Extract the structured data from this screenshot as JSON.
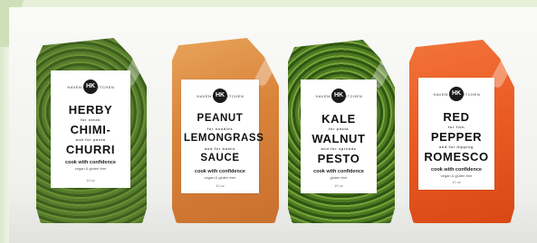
{
  "brand": {
    "left": "HAVEN'S",
    "right": "KITCHEN",
    "logo": "HK"
  },
  "products": [
    {
      "lines": [
        "HERBY",
        "CHIMI-",
        "CHURRI"
      ],
      "note1": "for steak",
      "note2": "and for pasta",
      "tagline": "cook with confidence",
      "diet": "vegan & gluten free",
      "net": "10 oz"
    },
    {
      "lines": [
        "PEANUT",
        "LEMONGRASS",
        "SAUCE"
      ],
      "note1": "for noodles",
      "note2": "and for bowls",
      "tagline": "cook with confidence",
      "diet": "vegan & gluten free",
      "net": "10 oz"
    },
    {
      "lines": [
        "KALE",
        "WALNUT",
        "PESTO"
      ],
      "note1": "for pasta",
      "note2": "and for spreads",
      "tagline": "cook with confidence",
      "diet": "gluten free",
      "net": "10 oz"
    },
    {
      "lines": [
        "RED",
        "PEPPER",
        "ROMESCO"
      ],
      "note1": "for fish",
      "note2": "and for dipping",
      "tagline": "cook with confidence",
      "diet": "vegan & gluten free",
      "net": "10 oz"
    }
  ],
  "colors": {
    "chimichurri": "#4f7427",
    "peanut": "#d9833a",
    "pesto": "#3f6a1a",
    "romesco": "#ea5a22",
    "frame": "#e6f0d8"
  }
}
